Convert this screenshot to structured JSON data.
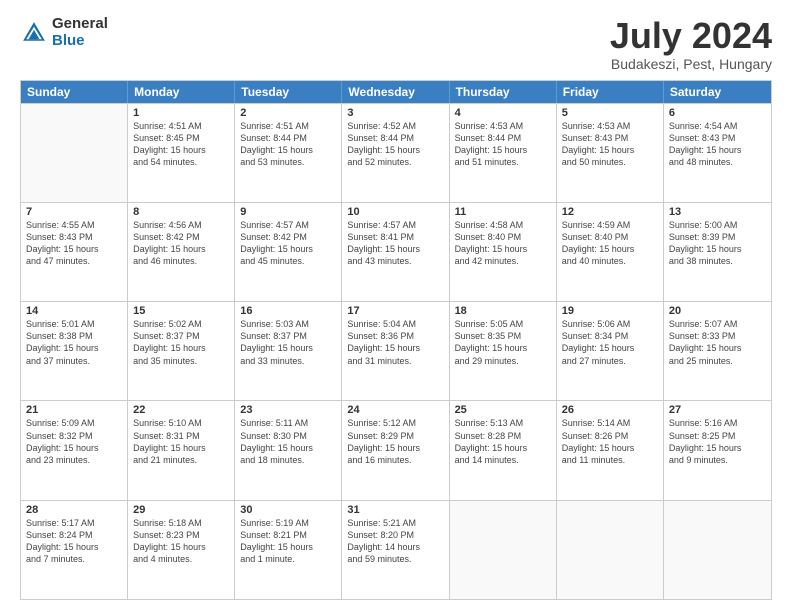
{
  "logo": {
    "general": "General",
    "blue": "Blue"
  },
  "header": {
    "title": "July 2024",
    "subtitle": "Budakeszi, Pest, Hungary"
  },
  "weekdays": [
    "Sunday",
    "Monday",
    "Tuesday",
    "Wednesday",
    "Thursday",
    "Friday",
    "Saturday"
  ],
  "rows": [
    [
      {
        "day": "",
        "lines": []
      },
      {
        "day": "1",
        "lines": [
          "Sunrise: 4:51 AM",
          "Sunset: 8:45 PM",
          "Daylight: 15 hours",
          "and 54 minutes."
        ]
      },
      {
        "day": "2",
        "lines": [
          "Sunrise: 4:51 AM",
          "Sunset: 8:44 PM",
          "Daylight: 15 hours",
          "and 53 minutes."
        ]
      },
      {
        "day": "3",
        "lines": [
          "Sunrise: 4:52 AM",
          "Sunset: 8:44 PM",
          "Daylight: 15 hours",
          "and 52 minutes."
        ]
      },
      {
        "day": "4",
        "lines": [
          "Sunrise: 4:53 AM",
          "Sunset: 8:44 PM",
          "Daylight: 15 hours",
          "and 51 minutes."
        ]
      },
      {
        "day": "5",
        "lines": [
          "Sunrise: 4:53 AM",
          "Sunset: 8:43 PM",
          "Daylight: 15 hours",
          "and 50 minutes."
        ]
      },
      {
        "day": "6",
        "lines": [
          "Sunrise: 4:54 AM",
          "Sunset: 8:43 PM",
          "Daylight: 15 hours",
          "and 48 minutes."
        ]
      }
    ],
    [
      {
        "day": "7",
        "lines": [
          "Sunrise: 4:55 AM",
          "Sunset: 8:43 PM",
          "Daylight: 15 hours",
          "and 47 minutes."
        ]
      },
      {
        "day": "8",
        "lines": [
          "Sunrise: 4:56 AM",
          "Sunset: 8:42 PM",
          "Daylight: 15 hours",
          "and 46 minutes."
        ]
      },
      {
        "day": "9",
        "lines": [
          "Sunrise: 4:57 AM",
          "Sunset: 8:42 PM",
          "Daylight: 15 hours",
          "and 45 minutes."
        ]
      },
      {
        "day": "10",
        "lines": [
          "Sunrise: 4:57 AM",
          "Sunset: 8:41 PM",
          "Daylight: 15 hours",
          "and 43 minutes."
        ]
      },
      {
        "day": "11",
        "lines": [
          "Sunrise: 4:58 AM",
          "Sunset: 8:40 PM",
          "Daylight: 15 hours",
          "and 42 minutes."
        ]
      },
      {
        "day": "12",
        "lines": [
          "Sunrise: 4:59 AM",
          "Sunset: 8:40 PM",
          "Daylight: 15 hours",
          "and 40 minutes."
        ]
      },
      {
        "day": "13",
        "lines": [
          "Sunrise: 5:00 AM",
          "Sunset: 8:39 PM",
          "Daylight: 15 hours",
          "and 38 minutes."
        ]
      }
    ],
    [
      {
        "day": "14",
        "lines": [
          "Sunrise: 5:01 AM",
          "Sunset: 8:38 PM",
          "Daylight: 15 hours",
          "and 37 minutes."
        ]
      },
      {
        "day": "15",
        "lines": [
          "Sunrise: 5:02 AM",
          "Sunset: 8:37 PM",
          "Daylight: 15 hours",
          "and 35 minutes."
        ]
      },
      {
        "day": "16",
        "lines": [
          "Sunrise: 5:03 AM",
          "Sunset: 8:37 PM",
          "Daylight: 15 hours",
          "and 33 minutes."
        ]
      },
      {
        "day": "17",
        "lines": [
          "Sunrise: 5:04 AM",
          "Sunset: 8:36 PM",
          "Daylight: 15 hours",
          "and 31 minutes."
        ]
      },
      {
        "day": "18",
        "lines": [
          "Sunrise: 5:05 AM",
          "Sunset: 8:35 PM",
          "Daylight: 15 hours",
          "and 29 minutes."
        ]
      },
      {
        "day": "19",
        "lines": [
          "Sunrise: 5:06 AM",
          "Sunset: 8:34 PM",
          "Daylight: 15 hours",
          "and 27 minutes."
        ]
      },
      {
        "day": "20",
        "lines": [
          "Sunrise: 5:07 AM",
          "Sunset: 8:33 PM",
          "Daylight: 15 hours",
          "and 25 minutes."
        ]
      }
    ],
    [
      {
        "day": "21",
        "lines": [
          "Sunrise: 5:09 AM",
          "Sunset: 8:32 PM",
          "Daylight: 15 hours",
          "and 23 minutes."
        ]
      },
      {
        "day": "22",
        "lines": [
          "Sunrise: 5:10 AM",
          "Sunset: 8:31 PM",
          "Daylight: 15 hours",
          "and 21 minutes."
        ]
      },
      {
        "day": "23",
        "lines": [
          "Sunrise: 5:11 AM",
          "Sunset: 8:30 PM",
          "Daylight: 15 hours",
          "and 18 minutes."
        ]
      },
      {
        "day": "24",
        "lines": [
          "Sunrise: 5:12 AM",
          "Sunset: 8:29 PM",
          "Daylight: 15 hours",
          "and 16 minutes."
        ]
      },
      {
        "day": "25",
        "lines": [
          "Sunrise: 5:13 AM",
          "Sunset: 8:28 PM",
          "Daylight: 15 hours",
          "and 14 minutes."
        ]
      },
      {
        "day": "26",
        "lines": [
          "Sunrise: 5:14 AM",
          "Sunset: 8:26 PM",
          "Daylight: 15 hours",
          "and 11 minutes."
        ]
      },
      {
        "day": "27",
        "lines": [
          "Sunrise: 5:16 AM",
          "Sunset: 8:25 PM",
          "Daylight: 15 hours",
          "and 9 minutes."
        ]
      }
    ],
    [
      {
        "day": "28",
        "lines": [
          "Sunrise: 5:17 AM",
          "Sunset: 8:24 PM",
          "Daylight: 15 hours",
          "and 7 minutes."
        ]
      },
      {
        "day": "29",
        "lines": [
          "Sunrise: 5:18 AM",
          "Sunset: 8:23 PM",
          "Daylight: 15 hours",
          "and 4 minutes."
        ]
      },
      {
        "day": "30",
        "lines": [
          "Sunrise: 5:19 AM",
          "Sunset: 8:21 PM",
          "Daylight: 15 hours",
          "and 1 minute."
        ]
      },
      {
        "day": "31",
        "lines": [
          "Sunrise: 5:21 AM",
          "Sunset: 8:20 PM",
          "Daylight: 14 hours",
          "and 59 minutes."
        ]
      },
      {
        "day": "",
        "lines": []
      },
      {
        "day": "",
        "lines": []
      },
      {
        "day": "",
        "lines": []
      }
    ]
  ]
}
